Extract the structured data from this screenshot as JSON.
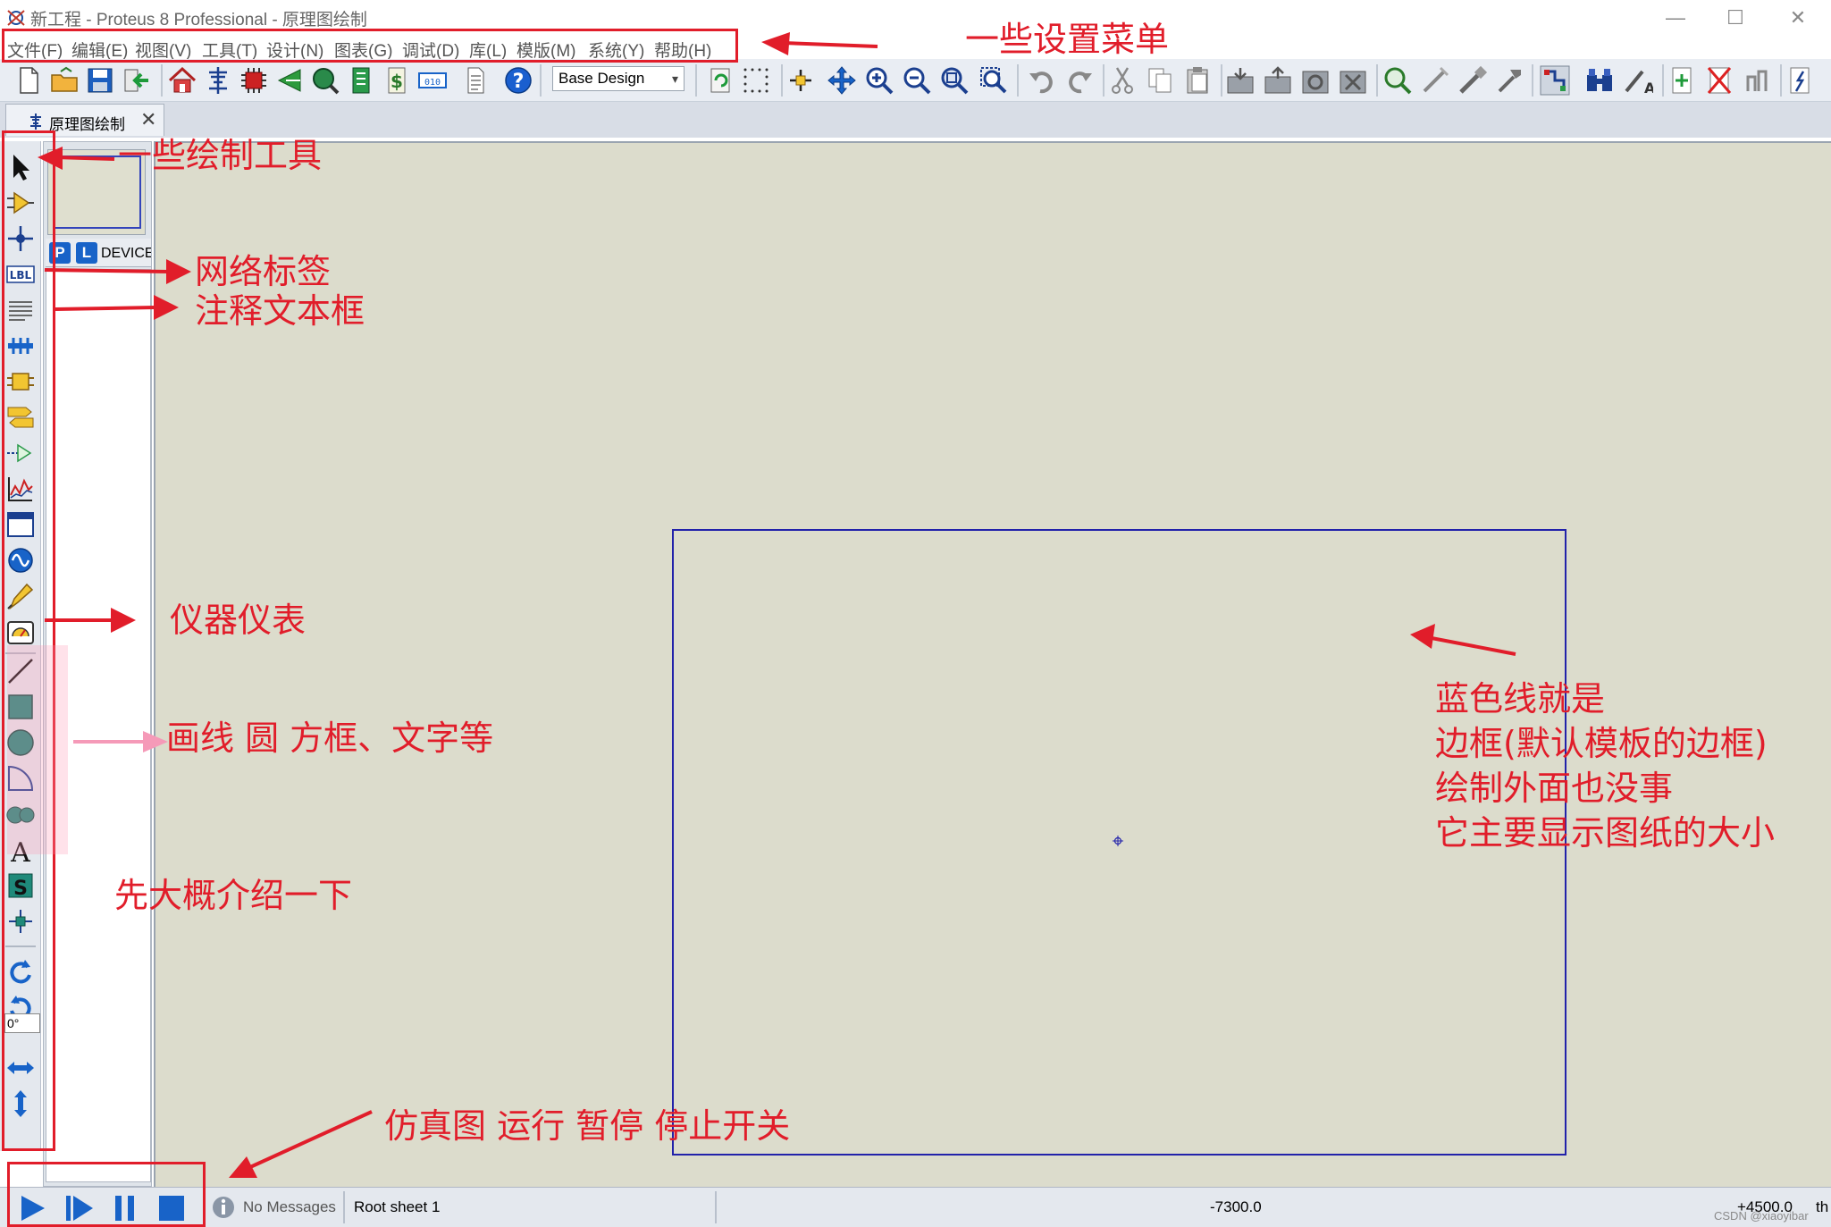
{
  "window": {
    "title": "新工程 - Proteus 8 Professional - 原理图绘制",
    "controls": {
      "minimize": "—",
      "maximize": "☐",
      "close": "✕"
    }
  },
  "menu": [
    {
      "label": "文件(F)"
    },
    {
      "label": "编辑(E)"
    },
    {
      "label": "视图(V)"
    },
    {
      "label": "工具(T)"
    },
    {
      "label": "设计(N)"
    },
    {
      "label": "图表(G)"
    },
    {
      "label": "调试(D)"
    },
    {
      "label": "库(L)"
    },
    {
      "label": "模版(M)"
    },
    {
      "label": "系统(Y)"
    },
    {
      "label": "帮助(H)"
    }
  ],
  "toolbar": {
    "design_variant": "Base Design",
    "icons": [
      "new-file-icon",
      "open-folder-icon",
      "save-icon",
      "import-icon",
      "home-icon",
      "schematic-icon",
      "pcb-icon",
      "gerber-icon",
      "3d-view-icon",
      "bom-icon",
      "dollar-icon",
      "binary-icon",
      "report-icon",
      "help-icon",
      "refresh-icon",
      "grid-icon",
      "origin-icon",
      "pan-icon",
      "zoom-in-icon",
      "zoom-out-icon",
      "zoom-all-icon",
      "zoom-area-icon",
      "undo-icon",
      "redo-icon",
      "cut-icon",
      "copy-icon",
      "paste-icon",
      "block-copy-icon",
      "block-move-icon",
      "block-rotate-icon",
      "block-delete-icon",
      "pick-device-icon",
      "make-device-icon",
      "package-tool-icon",
      "decompose-icon",
      "wire-autorouter-icon",
      "search-icon",
      "property-tool-icon",
      "new-sheet-icon",
      "delete-sheet-icon",
      "exit-sheet-icon",
      "netlist-icon"
    ]
  },
  "tab": {
    "label": "原理图绘制",
    "close": "✕"
  },
  "mode_tools": [
    "selection-mode-icon",
    "component-mode-icon",
    "junction-dot-icon",
    "wire-label-icon",
    "text-script-icon",
    "buses-icon",
    "subcircuit-icon",
    "terminals-icon",
    "device-pins-icon",
    "graph-icon",
    "active-popup-icon",
    "generator-icon",
    "voltage-probe-icon",
    "virtual-instruments-icon",
    "line-2d-icon",
    "box-2d-icon",
    "circle-2d-icon",
    "arc-2d-icon",
    "path-2d-icon",
    "text-2d-icon",
    "symbol-2d-icon",
    "marker-2d-icon",
    "rotate-clockwise-icon",
    "rotate-anticlockwise-icon",
    "mirror-x-icon",
    "mirror-y-icon"
  ],
  "rotation": "0°",
  "selector": {
    "pick_p": "P",
    "pick_l": "L",
    "list_title": "DEVICES"
  },
  "status": {
    "messages": "No Messages",
    "sheet": "Root sheet 1",
    "coord_x": "-7300.0",
    "coord_y": "+4500.0",
    "units": "th",
    "watermark": "CSDN @xiaoyibar"
  },
  "annotations": {
    "menus": "一些设置菜单",
    "draw_tools": "一些绘制工具",
    "net_label": "网络标签",
    "text_box": "注释文本框",
    "instruments": "仪器仪表",
    "shapes": "画线 圆 方框、文字等",
    "intro": "先大概介绍一下",
    "border_lines": [
      "蓝色线就是",
      "边框(默认模板的边框)",
      "绘制外面也没事",
      "它主要显示图纸的大小"
    ],
    "sim": "仿真图 运行 暂停 停止开关"
  },
  "colors": {
    "annotation": "#e11d2a",
    "canvas": "#dcdccc",
    "sheet_border": "#2222aa",
    "sim_blue": "#1863c8"
  }
}
